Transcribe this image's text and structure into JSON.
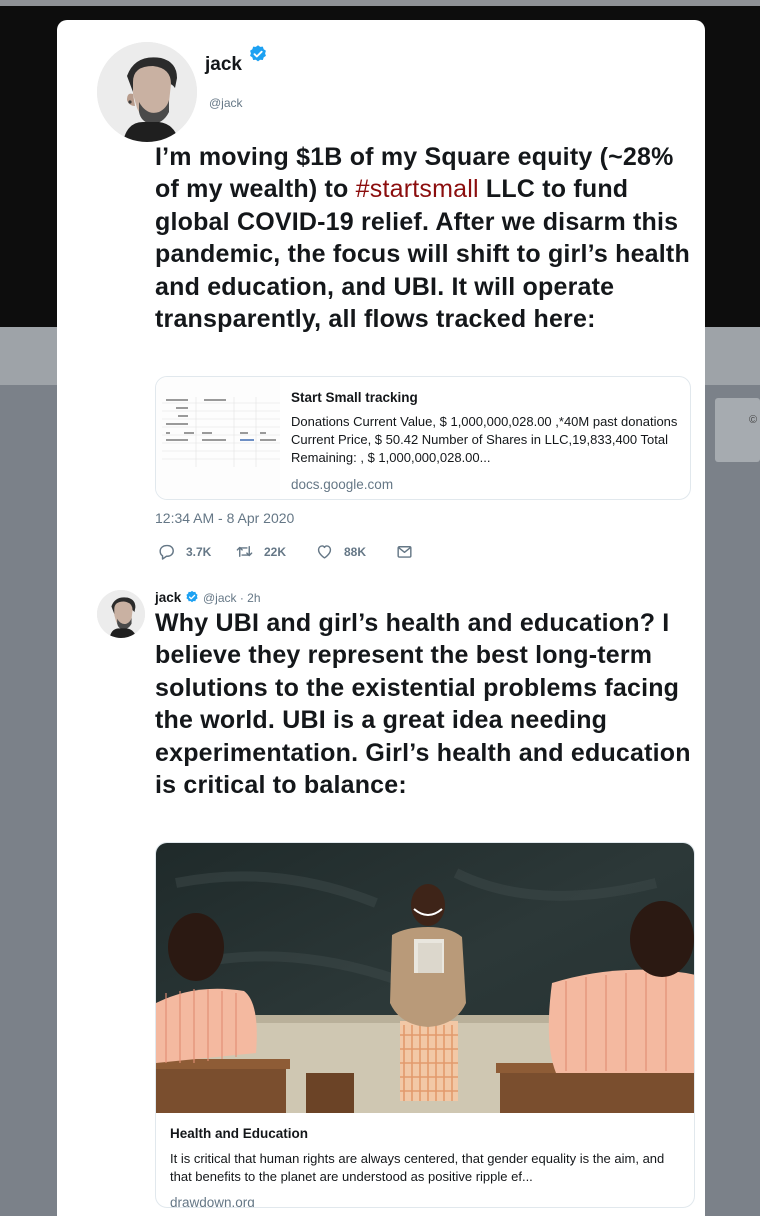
{
  "colors": {
    "link_red": "#8b0d0d",
    "verified_blue": "#1da1f2",
    "muted_gray": "#657786",
    "text_dark": "#14171a"
  },
  "page_corner_text": "©",
  "tweet_main": {
    "user": {
      "name": "jack",
      "handle": "@jack",
      "verified": true,
      "avatar_icon": "profile-photo"
    },
    "text_before_hashtag": "I’m moving $1B of my Square equity (~28% of my wealth) to ",
    "hashtag": "#startsmall",
    "text_after_hashtag": " LLC to fund global COVID-19 relief. After we disarm this pandemic, the focus will shift to girl’s health and education, and UBI. It will operate transparently, all flows tracked here:",
    "link_card": {
      "title": "Start Small tracking",
      "description": "Donations Current Value, $ 1,000,000,028.00 ,*40M past donations Current Price, $ 50.42 Number of Shares in LLC,19,833,400 Total Remaining: , $ 1,000,000,028.00...",
      "domain": "docs.google.com",
      "thumbnail_icon": "spreadsheet-thumbnail"
    },
    "timestamp": "12:34 AM - 8 Apr 2020",
    "actions": {
      "reply_count": "3.7K",
      "retweet_count": "22K",
      "like_count": "88K",
      "icons": [
        "reply-icon",
        "retweet-icon",
        "like-icon",
        "message-icon"
      ]
    }
  },
  "tweet_reply": {
    "user": {
      "name": "jack",
      "handle_time": "@jack · 2h",
      "verified": true
    },
    "text": "Why UBI and girl’s health and education? I believe they represent the best long-term solutions to the existential problems facing the world. UBI is a great idea needing experimentation. Girl’s health and education is critical to balance:",
    "card": {
      "title": "Health and Education",
      "description": "It is critical that human rights are always centered, that gender equality is the aim, and that benefits to the planet are understood as positive ripple ef...",
      "domain": "drawdown.org",
      "image_icon": "classroom-photo"
    }
  }
}
